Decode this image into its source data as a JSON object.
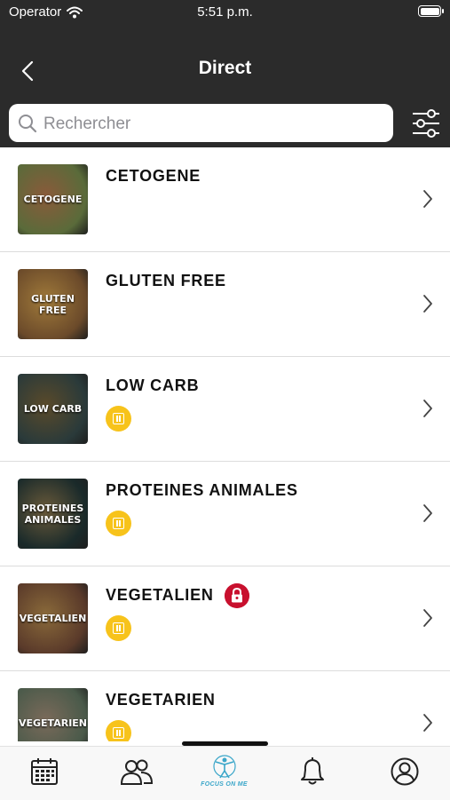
{
  "status_bar": {
    "carrier": "Operator",
    "time": "5:51 p.m."
  },
  "nav": {
    "title": "Direct"
  },
  "search": {
    "placeholder": "Rechercher"
  },
  "categories": [
    {
      "name": "CETOGENE",
      "thumb_label": "CETOGENE",
      "premium": false,
      "locked": false,
      "colors": [
        "#5a6b3a",
        "#8a5a3a"
      ]
    },
    {
      "name": "GLUTEN FREE",
      "thumb_label": "GLUTEN FREE",
      "premium": false,
      "locked": false,
      "colors": [
        "#6b4a2a",
        "#a07a3a"
      ]
    },
    {
      "name": "LOW CARB",
      "thumb_label": "LOW CARB",
      "premium": true,
      "locked": false,
      "colors": [
        "#2a3a3a",
        "#5a4a2a"
      ]
    },
    {
      "name": "PROTEINES ANIMALES",
      "thumb_label": "PROTEINES ANIMALES",
      "premium": true,
      "locked": false,
      "colors": [
        "#1a2a2a",
        "#6a5a3a"
      ]
    },
    {
      "name": "VEGETALIEN",
      "thumb_label": "VEGETALIEN",
      "premium": true,
      "locked": true,
      "colors": [
        "#5a3a2a",
        "#8a6a3a"
      ]
    },
    {
      "name": "VEGETARIEN",
      "thumb_label": "VEGETARIEN",
      "premium": true,
      "locked": false,
      "colors": [
        "#4a5a4a",
        "#7a6a5a"
      ]
    }
  ],
  "tabbar": {
    "focus_label": "FOCUS ON ME"
  },
  "colors": {
    "header_bg": "#2b2b2b",
    "premium_badge": "#f7c31b",
    "lock_badge": "#c8102e",
    "focus_accent": "#3aa6c9"
  }
}
